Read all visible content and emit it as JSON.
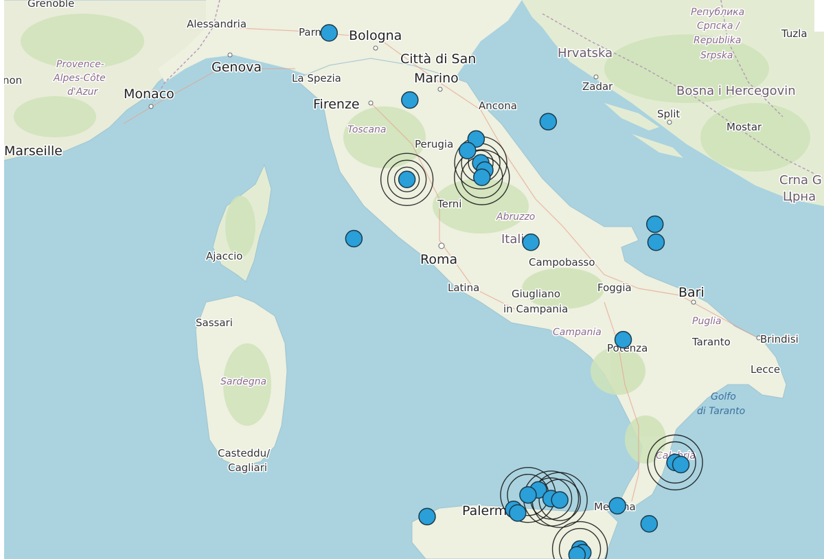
{
  "map": {
    "colors": {
      "sea": "#aad3df",
      "land": "#f2efe9",
      "forest": "#cfe3b8",
      "border": "#b79bb7",
      "marker_fill": "#2a9fd8",
      "marker_stroke": "#1b3a4b",
      "ring_stroke": "#111111"
    },
    "labels": {
      "grenoble": "Grenoble",
      "alessandria": "Alessandria",
      "parma": "Parma",
      "bologna": "Bologna",
      "citta_di_san": "Città di San",
      "marino": "Marino",
      "genova": "Genova",
      "la_spezia": "La Spezia",
      "provence1": "Provence-",
      "provence2": "Alpes-Côte",
      "provence3": "d'Azur",
      "non": "non",
      "monaco": "Monaco",
      "marseille": "Marseille",
      "firenze": "Firenze",
      "toscana": "Toscana",
      "ancona": "Ancona",
      "perugia": "Perugia",
      "terni": "Terni",
      "abruzzo": "Abruzzo",
      "italia": "Italia",
      "roma": "Roma",
      "campobasso": "Campobasso",
      "latina": "Latina",
      "giugliano1": "Giugliano",
      "giugliano2": "in Campania",
      "campania": "Campania",
      "foggia": "Foggia",
      "bari": "Bari",
      "puglia": "Puglia",
      "taranto": "Taranto",
      "brindisi": "Brindisi",
      "lecce": "Lecce",
      "potenza": "Potenza",
      "golfo1": "Golfo",
      "golfo2": "di Taranto",
      "calabria": "Calabria",
      "messina": "Messina",
      "palermo": "Palermo",
      "ajaccio": "Ajaccio",
      "sassari": "Sassari",
      "sardegna": "Sardegna",
      "casteddu": "Casteddu/",
      "cagliari": "Cagliari",
      "hrvatska": "Hrvatska",
      "zadar": "Zadar",
      "split": "Split",
      "bosna": "Bosna i Hercegovin",
      "mostar": "Mostar",
      "tuzla": "Tuzla",
      "republika1": "Република",
      "republika2": "Српска /",
      "republika3": "Republika",
      "republika4": "Srpska",
      "crna1": "Crna G",
      "crna2": "Црна"
    },
    "markers_note_hidden": "",
    "markers": [
      {
        "id": "m1",
        "lat": 44.85,
        "lon": 10.55
      },
      {
        "id": "m2",
        "lat": 43.92,
        "lon": 11.95
      },
      {
        "id": "m3",
        "lat": 43.62,
        "lon": 14.35
      },
      {
        "id": "m4",
        "lat": 43.38,
        "lon": 13.1
      },
      {
        "id": "m5",
        "lat": 43.22,
        "lon": 12.95
      },
      {
        "id": "m6",
        "lat": 43.05,
        "lon": 13.18
      },
      {
        "id": "m7",
        "lat": 42.95,
        "lon": 13.25
      },
      {
        "id": "m8",
        "lat": 42.85,
        "lon": 13.2
      },
      {
        "id": "m9",
        "lat": 42.82,
        "lon": 11.9
      },
      {
        "id": "m10",
        "lat": 42.0,
        "lon": 10.98
      },
      {
        "id": "m11",
        "lat": 41.95,
        "lon": 14.05
      },
      {
        "id": "m12",
        "lat": 42.2,
        "lon": 16.2
      },
      {
        "id": "m13",
        "lat": 41.95,
        "lon": 16.22
      },
      {
        "id": "m14",
        "lat": 40.6,
        "lon": 15.65
      },
      {
        "id": "m15",
        "lat": 38.9,
        "lon": 16.55
      },
      {
        "id": "m16",
        "lat": 38.87,
        "lon": 16.65
      },
      {
        "id": "m17",
        "lat": 38.52,
        "lon": 14.18
      },
      {
        "id": "m18",
        "lat": 38.45,
        "lon": 14.0
      },
      {
        "id": "m19",
        "lat": 38.4,
        "lon": 14.4
      },
      {
        "id": "m20",
        "lat": 38.38,
        "lon": 14.55
      },
      {
        "id": "m21",
        "lat": 38.25,
        "lon": 13.75
      },
      {
        "id": "m22",
        "lat": 38.2,
        "lon": 13.82
      },
      {
        "id": "m23",
        "lat": 38.3,
        "lon": 15.55
      },
      {
        "id": "m24",
        "lat": 38.15,
        "lon": 12.25
      },
      {
        "id": "m25",
        "lat": 38.05,
        "lon": 16.1
      },
      {
        "id": "m26",
        "lat": 37.7,
        "lon": 14.9
      },
      {
        "id": "m27",
        "lat": 37.65,
        "lon": 14.95
      },
      {
        "id": "m28",
        "lat": 37.62,
        "lon": 14.85
      }
    ],
    "rings": [
      {
        "of": "m9",
        "count": 3
      },
      {
        "of": "m6",
        "count": 3
      },
      {
        "of": "m8",
        "count": 2
      },
      {
        "of": "m15",
        "count": 2
      },
      {
        "of": "m18",
        "count": 2
      },
      {
        "of": "m19",
        "count": 2
      },
      {
        "of": "m20",
        "count": 2
      },
      {
        "of": "m26",
        "count": 2
      }
    ]
  }
}
